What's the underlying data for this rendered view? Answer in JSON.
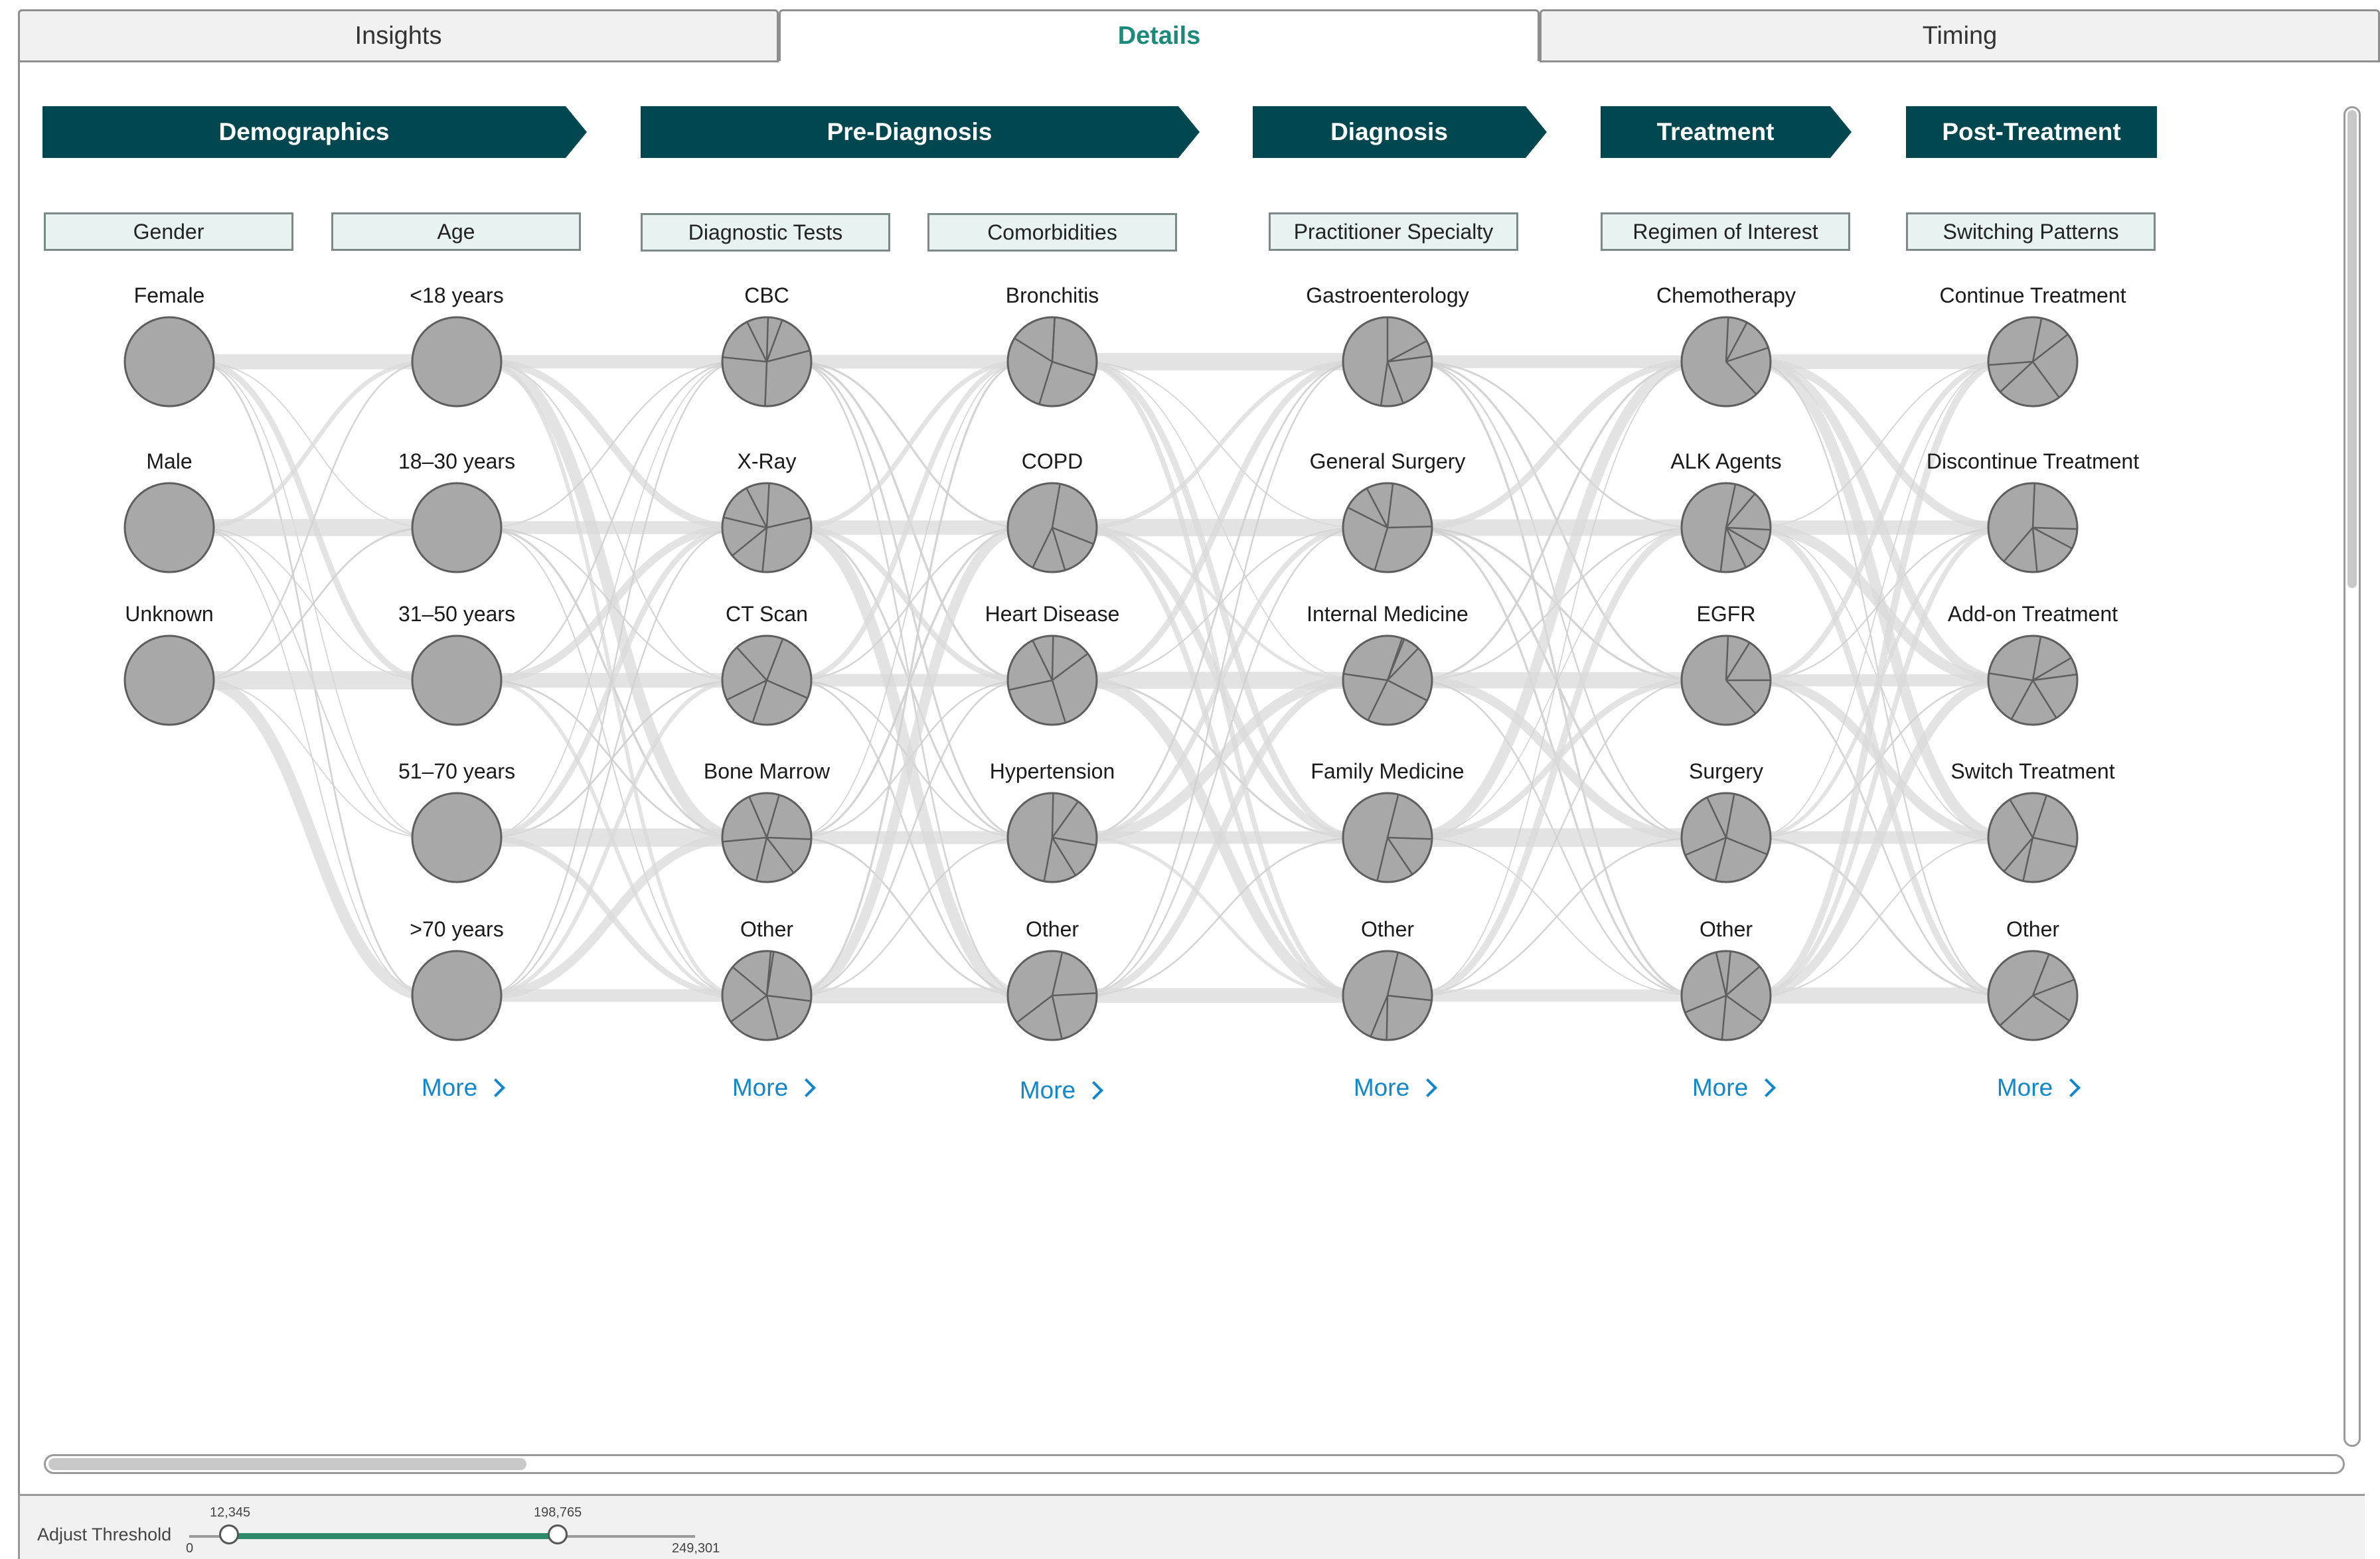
{
  "tabs": [
    {
      "label": "Insights",
      "active": false
    },
    {
      "label": "Details",
      "active": true
    },
    {
      "label": "Timing",
      "active": false
    }
  ],
  "stages": [
    "Demographics",
    "Pre-Diagnosis",
    "Diagnosis",
    "Treatment",
    "Post-Treatment"
  ],
  "categories": [
    "Gender",
    "Age",
    "Diagnostic Tests",
    "Comorbidities",
    "Practitioner Specialty",
    "Regimen of Interest",
    "Switching Patterns"
  ],
  "columns": [
    {
      "name": "Gender",
      "pie": false,
      "nodes": [
        "Female",
        "Male",
        "Unknown"
      ]
    },
    {
      "name": "Age",
      "pie": false,
      "nodes": [
        "<18 years",
        "18–30 years",
        "31–50 years",
        "51–70 years",
        ">70 years"
      ]
    },
    {
      "name": "Diagnostic Tests",
      "pie": true,
      "nodes": [
        "CBC",
        "X-Ray",
        "CT Scan",
        "Bone Marrow",
        "Other"
      ]
    },
    {
      "name": "Comorbidities",
      "pie": true,
      "nodes": [
        "Bronchitis",
        "COPD",
        "Heart Disease",
        "Hypertension",
        "Other"
      ]
    },
    {
      "name": "Practitioner Specialty",
      "pie": true,
      "nodes": [
        "Gastroenterology",
        "General Surgery",
        "Internal Medicine",
        "Family Medicine",
        "Other"
      ]
    },
    {
      "name": "Regimen of Interest",
      "pie": true,
      "nodes": [
        "Chemotherapy",
        "ALK Agents",
        "EGFR",
        "Surgery",
        "Other"
      ]
    },
    {
      "name": "Switching Patterns",
      "pie": true,
      "nodes": [
        "Continue Treatment",
        "Discontinue Treatment",
        "Add-on Treatment",
        "Switch Treatment",
        "Other"
      ]
    }
  ],
  "more_label": "More",
  "threshold": {
    "label": "Adjust Threshold",
    "min_label": "0",
    "max_label": "249,301",
    "low_label": "12,345",
    "high_label": "198,765",
    "min": 0,
    "max": 249301,
    "low": 12345,
    "high": 198765
  },
  "colors": {
    "stage": "#00474f",
    "accent": "#1a8a7a",
    "link": "#1188cc",
    "node": "#a8a8a8",
    "flow": "#d9d9d9",
    "slider": "#2d8a6b"
  },
  "icons": {
    "more": "chevron-right-icon"
  }
}
